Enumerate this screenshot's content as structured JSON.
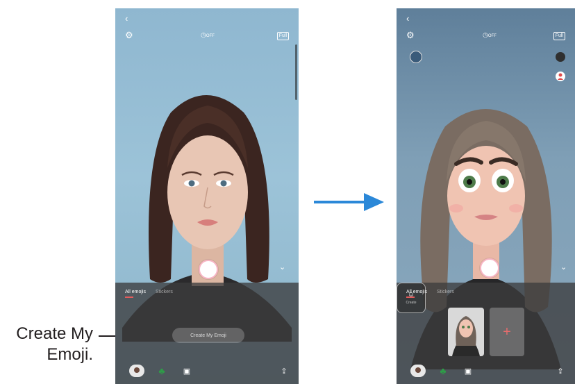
{
  "callout": {
    "line1": "Create My",
    "line2": "Emoji."
  },
  "left_screen": {
    "back_icon": "chevron-left-icon",
    "timer_label": "OFF",
    "full_label": "Full",
    "tabs": [
      "All emojis",
      "Stickers"
    ],
    "create_button_label": "Create My Emoji",
    "bottom_icons": [
      "avatar-icon",
      "clover-icon",
      "sticker-icon",
      "share-icon"
    ]
  },
  "right_screen": {
    "timer_label": "OFF",
    "full_label": "Full",
    "tabs": [
      "All emojis",
      "Stickers"
    ],
    "new_thumb_label": "Create",
    "add_thumb_label": "+"
  },
  "colors": {
    "accent": "#e45b5b",
    "arrow": "#2b88d8"
  }
}
